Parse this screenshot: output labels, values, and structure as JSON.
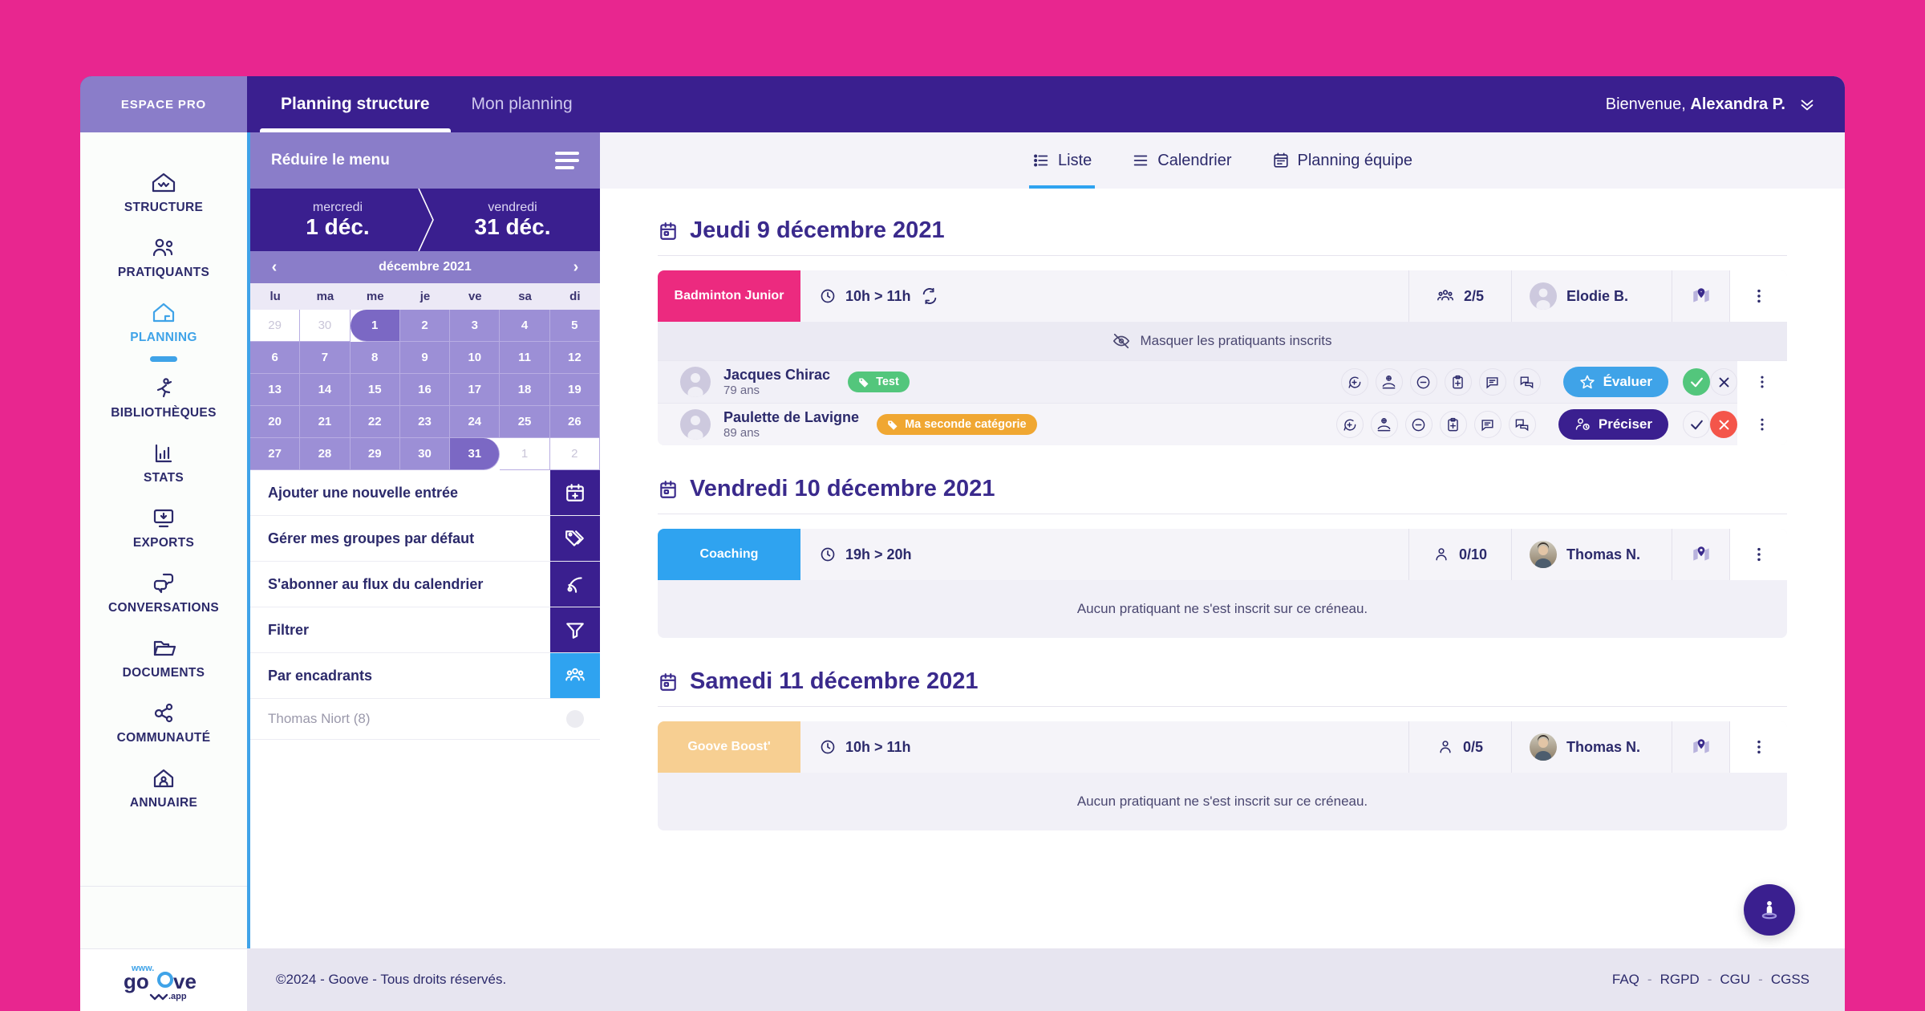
{
  "topbar": {
    "brand": "ESPACE PRO",
    "tabs": [
      {
        "label": "Planning structure",
        "active": true
      },
      {
        "label": "Mon planning",
        "active": false
      }
    ],
    "welcome_prefix": "Bienvenue,",
    "user_name": "Alexandra P."
  },
  "rail": {
    "items": [
      {
        "label": "STRUCTURE",
        "icon": "home-check-icon",
        "active": false
      },
      {
        "label": "PRATIQUANTS",
        "icon": "users-icon",
        "active": false
      },
      {
        "label": "PLANNING",
        "icon": "home-door-icon",
        "active": true
      },
      {
        "label": "BIBLIOTHÈQUES",
        "icon": "runner-icon",
        "active": false
      },
      {
        "label": "STATS",
        "icon": "bar-chart-icon",
        "active": false
      },
      {
        "label": "EXPORTS",
        "icon": "monitor-download-icon",
        "active": false
      },
      {
        "label": "CONVERSATIONS",
        "icon": "chat-bubbles-icon",
        "active": false
      },
      {
        "label": "DOCUMENTS",
        "icon": "folder-icon",
        "active": false
      },
      {
        "label": "COMMUNAUTÉ",
        "icon": "network-share-icon",
        "active": false
      },
      {
        "label": "ANNUAIRE",
        "icon": "address-book-icon",
        "active": false
      }
    ]
  },
  "panel": {
    "collapse_label": "Réduire le menu",
    "range": {
      "start_dow": "mercredi",
      "start_date": "1 déc.",
      "end_dow": "vendredi",
      "end_date": "31 déc."
    },
    "month_label": "décembre 2021",
    "prev_arrow": "‹",
    "next_arrow": "›",
    "weekdays": [
      "lu",
      "ma",
      "me",
      "je",
      "ve",
      "sa",
      "di"
    ],
    "days": [
      {
        "n": "29",
        "state": "muted"
      },
      {
        "n": "30",
        "state": "muted"
      },
      {
        "n": "1",
        "state": "edge-start"
      },
      {
        "n": "2",
        "state": "in"
      },
      {
        "n": "3",
        "state": "in"
      },
      {
        "n": "4",
        "state": "in"
      },
      {
        "n": "5",
        "state": "in"
      },
      {
        "n": "6",
        "state": "in"
      },
      {
        "n": "7",
        "state": "in"
      },
      {
        "n": "8",
        "state": "in"
      },
      {
        "n": "9",
        "state": "in"
      },
      {
        "n": "10",
        "state": "in"
      },
      {
        "n": "11",
        "state": "in"
      },
      {
        "n": "12",
        "state": "in"
      },
      {
        "n": "13",
        "state": "in"
      },
      {
        "n": "14",
        "state": "in"
      },
      {
        "n": "15",
        "state": "in"
      },
      {
        "n": "16",
        "state": "in"
      },
      {
        "n": "17",
        "state": "in"
      },
      {
        "n": "18",
        "state": "in"
      },
      {
        "n": "19",
        "state": "in"
      },
      {
        "n": "20",
        "state": "in"
      },
      {
        "n": "21",
        "state": "in"
      },
      {
        "n": "22",
        "state": "in"
      },
      {
        "n": "23",
        "state": "in"
      },
      {
        "n": "24",
        "state": "in"
      },
      {
        "n": "25",
        "state": "in"
      },
      {
        "n": "26",
        "state": "in"
      },
      {
        "n": "27",
        "state": "in"
      },
      {
        "n": "28",
        "state": "in"
      },
      {
        "n": "29",
        "state": "in"
      },
      {
        "n": "30",
        "state": "in"
      },
      {
        "n": "31",
        "state": "edge-end"
      },
      {
        "n": "1",
        "state": "muted"
      },
      {
        "n": "2",
        "state": "muted"
      }
    ],
    "menu": [
      {
        "label": "Ajouter une nouvelle entrée",
        "icon": "calendar-plus-icon",
        "style": "purple"
      },
      {
        "label": "Gérer mes groupes par défaut",
        "icon": "tags-icon",
        "style": "purple"
      },
      {
        "label": "S'abonner au flux du calendrier",
        "icon": "rss-icon",
        "style": "purple"
      },
      {
        "label": "Filtrer",
        "icon": "funnel-icon",
        "style": "purple"
      },
      {
        "label": "Par encadrants",
        "icon": "group-people-icon",
        "style": "blue"
      },
      {
        "label": "Thomas Niort (8)",
        "icon": "radio-dot-icon",
        "style": "sub"
      }
    ]
  },
  "view_tabs": [
    {
      "label": "Liste",
      "icon": "list-icon",
      "active": true
    },
    {
      "label": "Calendrier",
      "icon": "calendar-lines-icon",
      "active": false
    },
    {
      "label": "Planning équipe",
      "icon": "calendar-grid-icon",
      "active": false
    }
  ],
  "days": [
    {
      "title": "Jeudi 9 décembre 2021",
      "event": {
        "tag": "Badminton Junior",
        "tag_color": "#ec2a7f",
        "time": "10h > 11h",
        "recurring": true,
        "capacity": "2/5",
        "capacity_icon": "users-group-icon",
        "coach": "Elodie B.",
        "coach_avatar": "placeholder",
        "map_icon": "map-pin-icon",
        "more_icon": "kebab-icon"
      },
      "toggle_label": "Masquer les pratiquants inscrits",
      "toggle_icon": "eye-off-icon",
      "participants": [
        {
          "name": "Jacques Chirac",
          "age": "79 ans",
          "tag": "Test",
          "tag_color": "#53c67c",
          "cta_label": "Évaluer",
          "cta_icon": "star-icon",
          "cta_color": "#3fa3e8",
          "accept_state": "confirmed",
          "actions": [
            "add-comment-icon",
            "hand-plus-icon",
            "minus-circle-icon",
            "clipboard-plus-icon",
            "message-icon",
            "chat-duo-icon"
          ]
        },
        {
          "name": "Paulette de Lavigne",
          "age": "89 ans",
          "tag": "Ma seconde catégorie",
          "tag_color": "#f0a732",
          "cta_label": "Préciser",
          "cta_icon": "user-clock-icon",
          "cta_color": "#3a1f8f",
          "accept_state": "declined",
          "actions": [
            "add-comment-icon",
            "hand-plus-icon",
            "minus-circle-icon",
            "clipboard-plus-icon",
            "message-icon",
            "chat-duo-icon"
          ]
        }
      ]
    },
    {
      "title": "Vendredi 10 décembre 2021",
      "event": {
        "tag": "Coaching",
        "tag_color": "#2fa3f0",
        "time": "19h > 20h",
        "recurring": false,
        "capacity": "0/10",
        "capacity_icon": "user-single-icon",
        "coach": "Thomas N.",
        "coach_avatar": "photo",
        "map_icon": "map-pin-icon",
        "more_icon": "kebab-icon"
      },
      "empty_label": "Aucun pratiquant ne s'est inscrit sur ce créneau."
    },
    {
      "title": "Samedi 11 décembre 2021",
      "event": {
        "tag": "Goove Boost'",
        "tag_color": "#f7cf92",
        "time": "10h > 11h",
        "recurring": false,
        "capacity": "0/5",
        "capacity_icon": "user-single-icon",
        "coach": "Thomas N.",
        "coach_avatar": "photo",
        "map_icon": "map-pin-icon",
        "more_icon": "kebab-icon"
      },
      "empty_label": "Aucun pratiquant ne s'est inscrit sur ce créneau."
    }
  ],
  "fab": {
    "icon": "person-spotlight-icon"
  },
  "footer": {
    "logo_www": "www.",
    "logo_main": "goove",
    "logo_app": ".app",
    "copyright": "©2024 - Goove - Tous droits réservés.",
    "links": [
      "FAQ",
      "RGPD",
      "CGU",
      "CGSS"
    ],
    "separator": "-"
  },
  "colors": {
    "page_bg": "#e8268f",
    "deep_purple": "#3a1f8f",
    "light_purple": "#8a7dc9",
    "accent_blue": "#2fa3f0",
    "pink": "#ec2a7f",
    "green": "#53c67c",
    "red": "#f4554a",
    "orange": "#f0a732"
  }
}
